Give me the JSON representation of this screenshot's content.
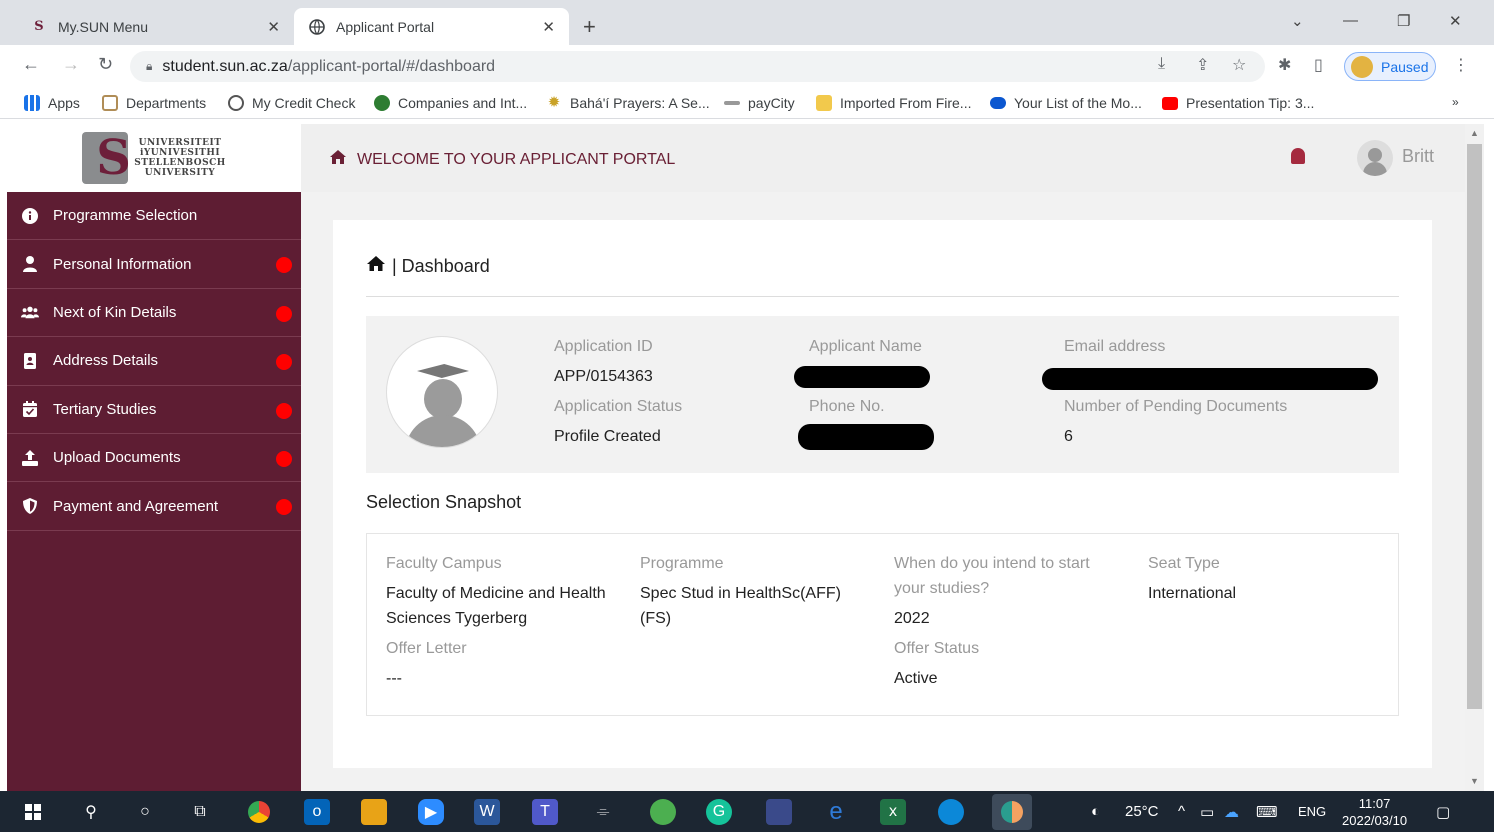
{
  "browser": {
    "tabs": [
      {
        "title": "My.SUN Menu",
        "icon": "sun-s-icon",
        "active": false
      },
      {
        "title": "Applicant Portal",
        "icon": "globe-icon",
        "active": true
      }
    ],
    "url_host": "student.sun.ac.za",
    "url_path": "/applicant-portal/#/dashboard",
    "profile_status": "Paused",
    "bookmarks": [
      {
        "label": "Apps",
        "icon": "apps-grid-icon",
        "color": "#1a73e8"
      },
      {
        "label": "Departments",
        "icon": "sun-crest-icon",
        "color": "#b08d57"
      },
      {
        "label": "My Credit Check",
        "icon": "credit-check-icon",
        "color": "#555555"
      },
      {
        "label": "Companies and Int...",
        "icon": "companies-icon",
        "color": "#2e7d32"
      },
      {
        "label": "Bahá'í Prayers: A Se...",
        "icon": "star-icon",
        "color": "#c9a227"
      },
      {
        "label": "payCity",
        "icon": "paycity-icon",
        "color": "#999999"
      },
      {
        "label": "Imported From Fire...",
        "icon": "folder-icon",
        "color": "#f2c94c"
      },
      {
        "label": "Your List of the Mo...",
        "icon": "cloud-icon",
        "color": "#0b57d0"
      },
      {
        "label": "Presentation Tip: 3...",
        "icon": "youtube-icon",
        "color": "#ff0000"
      }
    ]
  },
  "portal": {
    "logo_text": [
      "UNIVERSITEIT",
      "iYUNIVESITHI",
      "STELLENBOSCH",
      "UNIVERSITY"
    ],
    "header_title": "WELCOME TO YOUR APPLICANT PORTAL",
    "user_name": "Britt",
    "sidebar": [
      {
        "label": "Programme Selection",
        "icon": "info-icon",
        "pending": false
      },
      {
        "label": "Personal Information",
        "icon": "user-icon",
        "pending": true
      },
      {
        "label": "Next of Kin Details",
        "icon": "users-icon",
        "pending": true
      },
      {
        "label": "Address Details",
        "icon": "address-book-icon",
        "pending": true
      },
      {
        "label": "Tertiary Studies",
        "icon": "calendar-check-icon",
        "pending": true
      },
      {
        "label": "Upload Documents",
        "icon": "upload-icon",
        "pending": true
      },
      {
        "label": "Payment and Agreement",
        "icon": "shield-icon",
        "pending": true
      }
    ],
    "breadcrumb": "| Dashboard",
    "profile": {
      "application_id_label": "Application ID",
      "application_id": "APP/0154363",
      "status_label": "Application Status",
      "status": "Profile Created",
      "name_label": "Applicant Name",
      "phone_label": "Phone No.",
      "email_label": "Email address",
      "pending_docs_label": "Number of Pending Documents",
      "pending_docs": "6"
    },
    "snapshot": {
      "title": "Selection Snapshot",
      "faculty_label": "Faculty Campus",
      "faculty_line1": "Faculty of Medicine and Health",
      "faculty_line2": "Sciences Tygerberg",
      "programme_label": "Programme",
      "programme_line1": "Spec Stud in HealthSc(AFF)",
      "programme_line2": "(FS)",
      "start_label_line1": "When do you intend to start",
      "start_label_line2": "your studies?",
      "start_value": "2022",
      "seat_label": "Seat Type",
      "seat_value": "International",
      "offer_letter_label": "Offer Letter",
      "offer_letter_value": "---",
      "offer_status_label": "Offer Status",
      "offer_status_value": "Active"
    },
    "colors": {
      "sidebar": "#5e1d33",
      "accent": "#6a2035",
      "pending_dot": "#ff0000"
    }
  },
  "taskbar": {
    "weather": "25°C",
    "language": "ENG",
    "time": "11:07",
    "date": "2022/03/10"
  }
}
